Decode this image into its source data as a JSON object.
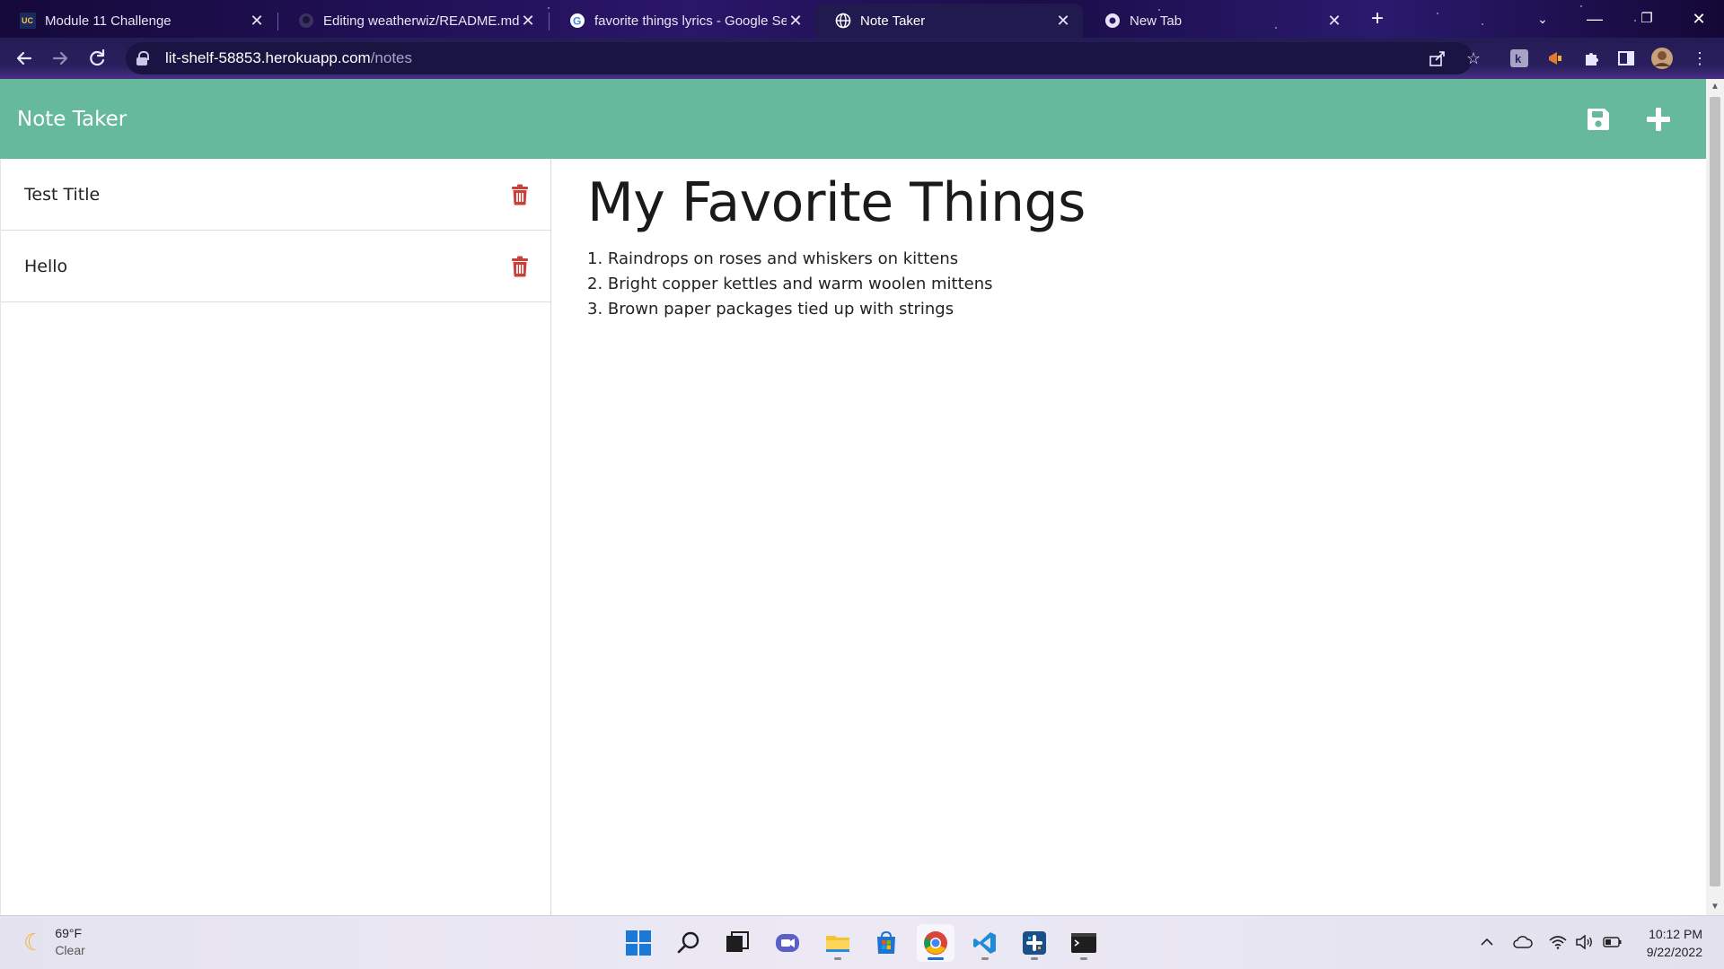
{
  "browser": {
    "tabs": [
      {
        "title": "Module 11 Challenge",
        "favicon": "uc-davis-icon",
        "active": false
      },
      {
        "title": "Editing weatherwiz/README.md",
        "favicon": "github-icon",
        "active": false
      },
      {
        "title": "favorite things lyrics - Google Se",
        "favicon": "google-icon",
        "active": false
      },
      {
        "title": "Note Taker",
        "favicon": "globe-icon",
        "active": true
      },
      {
        "title": "New Tab",
        "favicon": "chrome-icon",
        "active": false
      }
    ],
    "new_tab_label": "+",
    "url_host": "lit-shelf-58853.herokuapp.com",
    "url_path": "/notes"
  },
  "app": {
    "brand": "Note Taker",
    "accent": "#66b99c",
    "trash_color": "#c9413a",
    "notes": [
      {
        "title": "Test Title"
      },
      {
        "title": "Hello"
      }
    ],
    "active_note": {
      "title": "My Favorite Things",
      "lines": [
        "1. Raindrops on roses and whiskers on kittens",
        "2. Bright copper kettles and warm woolen mittens",
        "3. Brown paper packages tied up with strings"
      ]
    }
  },
  "taskbar": {
    "weather": {
      "temp": "69°F",
      "condition": "Clear"
    },
    "apps": [
      "windows-start-icon",
      "search-icon",
      "task-view-icon",
      "teams-chat-icon",
      "file-explorer-icon",
      "store-icon",
      "chrome-icon",
      "vscode-icon",
      "slack-icon",
      "terminal-icon"
    ],
    "time": "10:12 PM",
    "date": "9/22/2022"
  }
}
